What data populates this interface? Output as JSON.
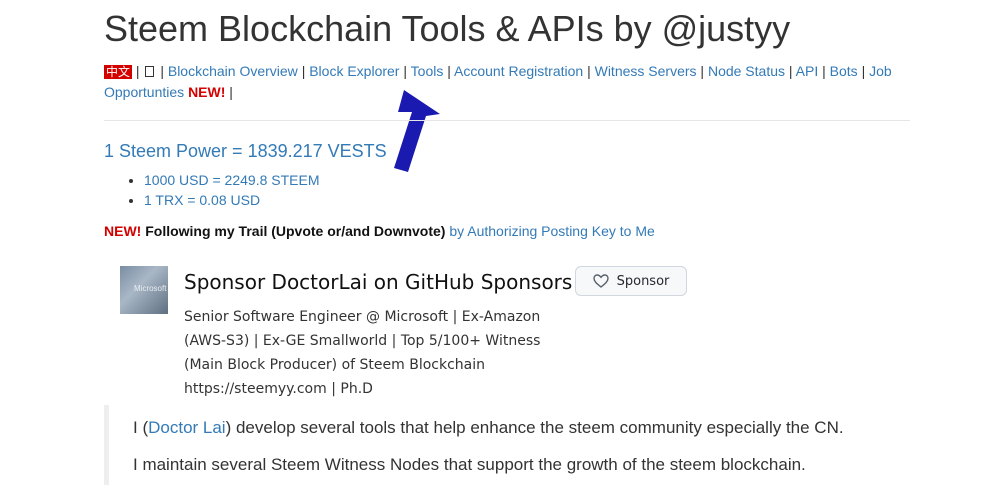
{
  "header": {
    "title": "Steem Blockchain Tools & APIs by @justyy"
  },
  "nav": {
    "lang_badge": "中文",
    "items": [
      "Blockchain Overview",
      "Block Explorer",
      "Tools",
      "Account Registration",
      "Witness Servers",
      "Node Status",
      "API",
      "Bots",
      "Job Opportunties"
    ],
    "new_label": "NEW!"
  },
  "steem_power": {
    "title": "1 Steem Power = 1839.217 VESTS",
    "rates": [
      "1000 USD = 2249.8 STEEM",
      "1 TRX = 0.08 USD"
    ]
  },
  "trail": {
    "new_label": "NEW!",
    "text": "Following my Trail (Upvote or/and Downvote)",
    "link": "by Authorizing Posting Key to Me"
  },
  "sponsor": {
    "avatar_text": "Microsoft",
    "title": "Sponsor DoctorLai on GitHub Sponsors",
    "button_label": "Sponsor",
    "description": "Senior Software Engineer @ Microsoft | Ex-Amazon (AWS-S3) | Ex-GE Smallworld | Top 5/100+ Witness (Main Block Producer) of Steem Blockchain https://steemyy.com | Ph.D"
  },
  "quote": {
    "line1_prefix": "I (",
    "line1_link": "Doctor Lai",
    "line1_suffix": ") develop several tools that help enhance the steem community especially the CN.",
    "line2": "I maintain several Steem Witness Nodes that support the growth of the steem blockchain."
  },
  "colors": {
    "link": "#337ab7",
    "new": "#d40000",
    "arrow": "#1a1ab0"
  }
}
